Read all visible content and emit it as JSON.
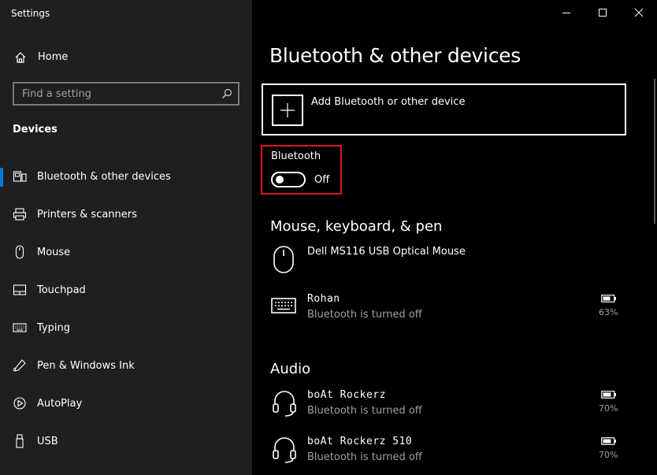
{
  "window": {
    "title": "Settings",
    "controls": [
      "minimize",
      "maximize",
      "close"
    ]
  },
  "sidebar": {
    "home_label": "Home",
    "search_placeholder": "Find a setting",
    "section_header": "Devices",
    "items": [
      {
        "label": "Bluetooth & other devices",
        "icon": "bluetooth-devices-icon",
        "active": true
      },
      {
        "label": "Printers & scanners",
        "icon": "printer-icon",
        "active": false
      },
      {
        "label": "Mouse",
        "icon": "mouse-icon",
        "active": false
      },
      {
        "label": "Touchpad",
        "icon": "touchpad-icon",
        "active": false
      },
      {
        "label": "Typing",
        "icon": "keyboard-icon",
        "active": false
      },
      {
        "label": "Pen & Windows Ink",
        "icon": "pen-icon",
        "active": false
      },
      {
        "label": "AutoPlay",
        "icon": "autoplay-icon",
        "active": false
      },
      {
        "label": "USB",
        "icon": "usb-icon",
        "active": false
      }
    ]
  },
  "main": {
    "page_title": "Bluetooth & other devices",
    "add_device_label": "Add Bluetooth or other device",
    "bluetooth": {
      "label": "Bluetooth",
      "state": "Off"
    },
    "groups": [
      {
        "title": "Mouse, keyboard, & pen",
        "devices": [
          {
            "name": "Dell MS116 USB Optical Mouse",
            "status": "",
            "icon": "mouse-icon",
            "battery": ""
          },
          {
            "name": "Rohan",
            "status": "Bluetooth is turned off",
            "icon": "keyboard-icon",
            "battery": "63%"
          }
        ]
      },
      {
        "title": "Audio",
        "devices": [
          {
            "name": "boAt Rockerz",
            "status": "Bluetooth is turned off",
            "icon": "headset-icon",
            "battery": "70%"
          },
          {
            "name": "boAt Rockerz 510",
            "status": "Bluetooth is turned off",
            "icon": "headset-icon",
            "battery": "70%"
          }
        ]
      }
    ]
  },
  "colors": {
    "sidebar_bg": "#1f1f1f",
    "main_bg": "#000000",
    "accent": "#0078d7",
    "highlight": "#e0141e",
    "secondary_text": "#a0a0a0"
  }
}
